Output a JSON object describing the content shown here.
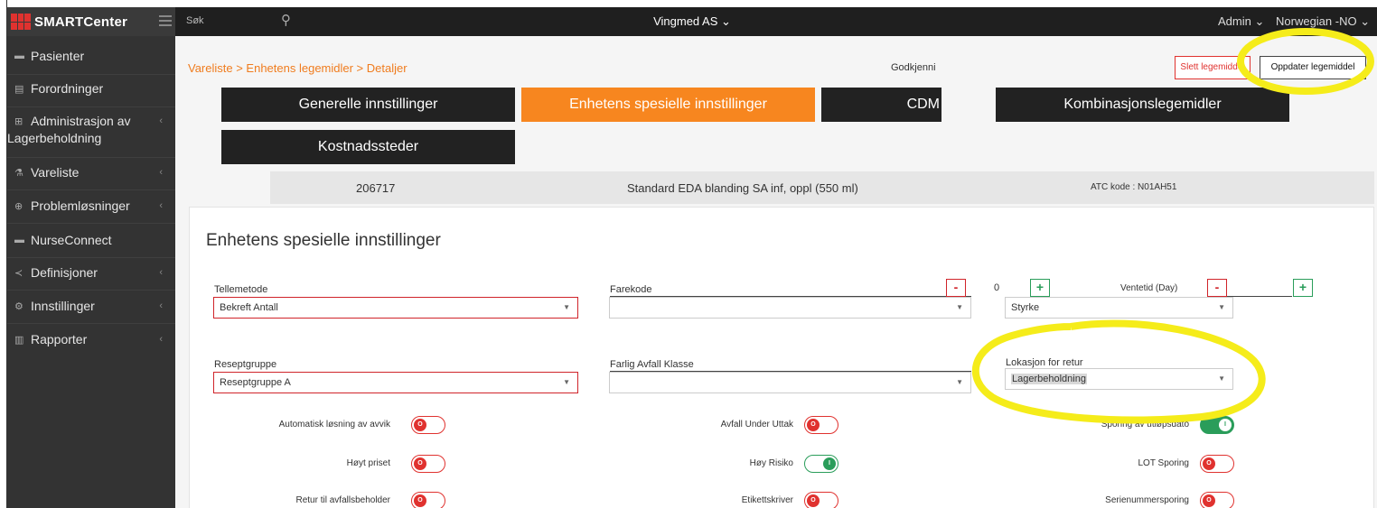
{
  "topbar": {
    "brand": "SMARTCenter",
    "search_label": "Søk",
    "organization": "Vingmed AS ⌄",
    "admin": "Admin ⌄",
    "language": "Norwegian -NO ⌄"
  },
  "sidebar": {
    "items": [
      {
        "label": "Pasienter"
      },
      {
        "label": "Forordninger"
      },
      {
        "label": "Administrasjon av",
        "label2": "Lagerbeholdning"
      },
      {
        "label": "Vareliste"
      },
      {
        "label": "Problemløsninger"
      },
      {
        "label": "NurseConnect"
      },
      {
        "label": "Definisjoner"
      },
      {
        "label": "Innstillinger"
      },
      {
        "label": "Rapporter"
      }
    ]
  },
  "main": {
    "breadcrumb": "Vareliste > Enhetens legemidler > Detaljer",
    "godkjenni": "Godkjenni",
    "delete_label": "Slett legemiddel",
    "update_label": "Oppdater legemiddel",
    "tabs": [
      {
        "label": "Generelle innstillinger"
      },
      {
        "label": "Enhetens spesielle innstillinger",
        "active": true
      },
      {
        "label": "CDM"
      },
      {
        "label": "Kombinasjonslegemidler"
      },
      {
        "label": "Kostnadssteder"
      }
    ],
    "product": {
      "id": "206717",
      "name": "Standard EDA blanding SA inf, oppl (550 ml)",
      "atc": "ATC kode : N01AH51"
    },
    "panel": {
      "title": "Enhetens spesielle innstillinger",
      "tellemetode": {
        "label": "Tellemetode",
        "value": "Bekreft Antall"
      },
      "farekode": {
        "label": "Farekode",
        "value": ""
      },
      "stepper_1": {
        "minus": "-",
        "value": "0",
        "plus": "+"
      },
      "ventetid": {
        "label": "Ventetid (Day)",
        "minus": "-",
        "plus": "+"
      },
      "styrke": {
        "value": "Styrke"
      },
      "reseptgruppe": {
        "label": "Reseptgruppe",
        "value": "Reseptgruppe A"
      },
      "farlig_avfall": {
        "label": "Farlig Avfall Klasse",
        "value": ""
      },
      "lokasjon": {
        "label": "Lokasjon for retur",
        "value": "Lagerbeholdning"
      },
      "toggles": [
        {
          "label": "Automatisk løsning av avvik",
          "state": "off",
          "knob": "O"
        },
        {
          "label": "Avfall Under Uttak",
          "state": "off",
          "knob": "O"
        },
        {
          "label": "Sporing av utløpsdato",
          "state": "on-filled",
          "knob": "I"
        },
        {
          "label": "Høyt priset",
          "state": "off",
          "knob": "O"
        },
        {
          "label": "Høy Risiko",
          "state": "on",
          "knob": "I"
        },
        {
          "label": "LOT Sporing",
          "state": "off",
          "knob": "O"
        },
        {
          "label": "Retur til avfallsbeholder",
          "state": "off",
          "knob": "O"
        },
        {
          "label": "Etikettskriver",
          "state": "off",
          "knob": "O"
        },
        {
          "label": "Serienummersporing",
          "state": "off",
          "knob": "O"
        }
      ]
    }
  },
  "colors": {
    "accent": "#f7861f",
    "danger": "#e0322f",
    "success": "#2a9d5a",
    "annotation": "#f5ec1a"
  }
}
